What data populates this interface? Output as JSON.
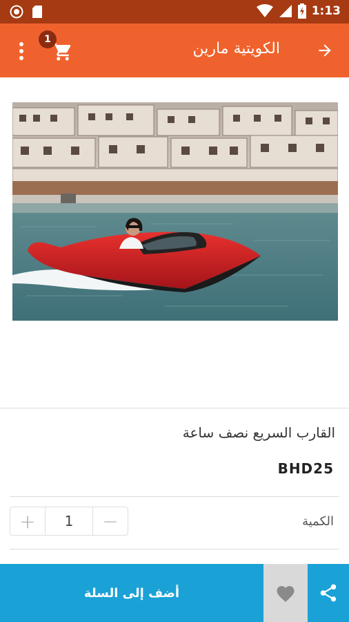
{
  "status_bar": {
    "time": "1:13"
  },
  "app_bar": {
    "title": "الكويتية مارين",
    "cart_count": "1"
  },
  "product": {
    "name": "القارب السريع نصف ساعة",
    "price": "BHD25",
    "image_icon": "speedboat-photo"
  },
  "quantity": {
    "label": "الكمية",
    "value": "1",
    "plus": "+",
    "minus": "−"
  },
  "bottom_bar": {
    "add_to_cart_label": "أضف إلى السلة"
  },
  "colors": {
    "status_bar": "#a63a12",
    "app_bar": "#f0622d",
    "accent": "#1aa1d6",
    "favorite_bg": "#d9d9d9"
  }
}
